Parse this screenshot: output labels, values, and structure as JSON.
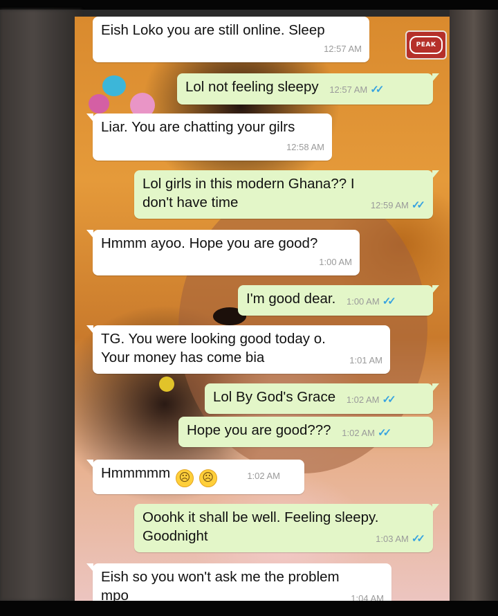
{
  "app": {
    "name": "WhatsApp chat screenshot",
    "watermark": {
      "text": "PEAK",
      "icon": "news-logo-icon"
    }
  },
  "colors": {
    "incoming_bubble": "#ffffff",
    "outgoing_bubble": "#e3f6c8",
    "read_ticks": "#38a3e0",
    "timestamp": "#9a9a9a"
  },
  "messages": [
    {
      "direction": "in",
      "text": "Eish Loko you are still online. Sleep",
      "time": "12:57 AM"
    },
    {
      "direction": "out",
      "text": "Lol not feeling sleepy",
      "time": "12:57 AM",
      "status": "read",
      "status_icon": "double-check-icon"
    },
    {
      "direction": "in",
      "text": "Liar. You are chatting your gilrs",
      "time": "12:58 AM"
    },
    {
      "direction": "out",
      "text_lines": [
        "Lol girls in this modern Ghana?? I",
        "don't have time"
      ],
      "time": "12:59 AM",
      "status": "read",
      "status_icon": "double-check-icon"
    },
    {
      "direction": "in",
      "text": "Hmmm ayoo. Hope you are good?",
      "time": "1:00 AM"
    },
    {
      "direction": "out",
      "text": "I'm good dear.",
      "time": "1:00 AM",
      "status": "read",
      "status_icon": "double-check-icon"
    },
    {
      "direction": "in",
      "text_lines": [
        "TG. You were looking good today o.",
        "Your money has come bia"
      ],
      "time": "1:01 AM"
    },
    {
      "direction": "out",
      "text": "Lol By God's Grace",
      "time": "1:02 AM",
      "status": "read",
      "status_icon": "double-check-icon"
    },
    {
      "direction": "out",
      "text": "Hope you are good???",
      "time": "1:02 AM",
      "status": "read",
      "status_icon": "double-check-icon"
    },
    {
      "direction": "in",
      "text": "Hmmmmm",
      "emojis": [
        "frowning-face-icon",
        "frowning-face-icon"
      ],
      "time": "1:02 AM"
    },
    {
      "direction": "out",
      "text_lines": [
        "Ooohk it shall be well. Feeling sleepy.",
        "Goodnight"
      ],
      "time": "1:03 AM",
      "status": "read",
      "status_icon": "double-check-icon"
    },
    {
      "direction": "in",
      "text_lines": [
        "Eish so you won't ask me the problem",
        "mpo"
      ],
      "time": "1:04 AM"
    }
  ]
}
